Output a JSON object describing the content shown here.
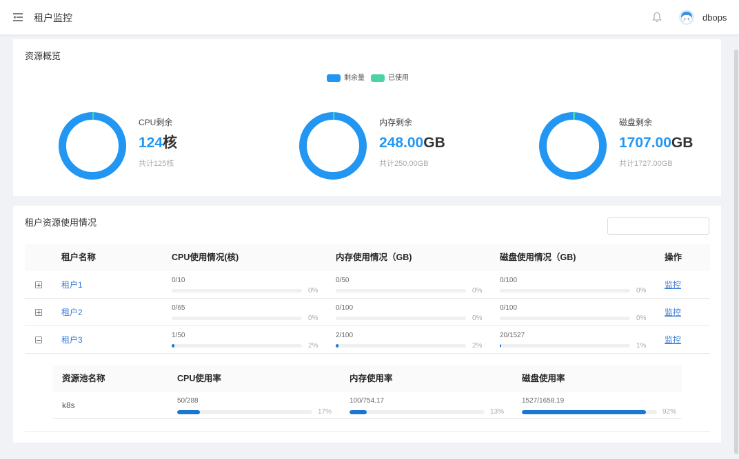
{
  "header": {
    "menu_icon": "menu-fold-icon",
    "title": "租户监控",
    "bell_icon": "bell-icon",
    "username": "dbops"
  },
  "overview": {
    "title": "资源概览",
    "legend": [
      {
        "label": "剩余量",
        "color": "#2196f3"
      },
      {
        "label": "已使用",
        "color": "#4cd3a5"
      }
    ],
    "items": [
      {
        "label": "CPU剩余",
        "value": "124",
        "unit": "核",
        "total_text": "共计125核",
        "remaining": 124,
        "total": 125
      },
      {
        "label": "内存剩余",
        "value": "248.00",
        "unit": "GB",
        "total_text": "共计250.00GB",
        "remaining": 248,
        "total": 250
      },
      {
        "label": "磁盘剩余",
        "value": "1707.00",
        "unit": "GB",
        "total_text": "共计1727.00GB",
        "remaining": 1707,
        "total": 1727
      }
    ]
  },
  "tenants": {
    "title": "租户资源使用情况",
    "columns": {
      "name": "租户名称",
      "cpu": "CPU使用情况(核)",
      "memory": "内存使用情况（GB)",
      "disk": "磁盘使用情况（GB)",
      "action": "操作"
    },
    "rows": [
      {
        "name": "租户1",
        "expanded": false,
        "cpu": {
          "text": "0/10",
          "percent": 0,
          "percent_text": "0%"
        },
        "memory": {
          "text": "0/50",
          "percent": 0,
          "percent_text": "0%"
        },
        "disk": {
          "text": "0/100",
          "percent": 0,
          "percent_text": "0%"
        },
        "action": "监控"
      },
      {
        "name": "租户2",
        "expanded": false,
        "cpu": {
          "text": "0/65",
          "percent": 0,
          "percent_text": "0%"
        },
        "memory": {
          "text": "0/100",
          "percent": 0,
          "percent_text": "0%"
        },
        "disk": {
          "text": "0/100",
          "percent": 0,
          "percent_text": "0%"
        },
        "action": "监控"
      },
      {
        "name": "租户3",
        "expanded": true,
        "cpu": {
          "text": "1/50",
          "percent": 2,
          "percent_text": "2%"
        },
        "memory": {
          "text": "2/100",
          "percent": 2,
          "percent_text": "2%"
        },
        "disk": {
          "text": "20/1527",
          "percent": 1,
          "percent_text": "1%"
        },
        "action": "监控",
        "pools": {
          "columns": {
            "name": "资源池名称",
            "cpu": "CPU使用率",
            "memory": "内存使用率",
            "disk": "磁盘使用率"
          },
          "rows": [
            {
              "name": "k8s",
              "cpu": {
                "text": "50/288",
                "percent": 17,
                "percent_text": "17%"
              },
              "memory": {
                "text": "100/754.17",
                "percent": 13,
                "percent_text": "13%"
              },
              "disk": {
                "text": "1527/1658.19",
                "percent": 92,
                "percent_text": "92%"
              }
            }
          ]
        }
      }
    ]
  },
  "colors": {
    "accent": "#2196f3",
    "used": "#4cd3a5",
    "link": "#3a7bd5",
    "progress_fill": "#1976d2"
  }
}
